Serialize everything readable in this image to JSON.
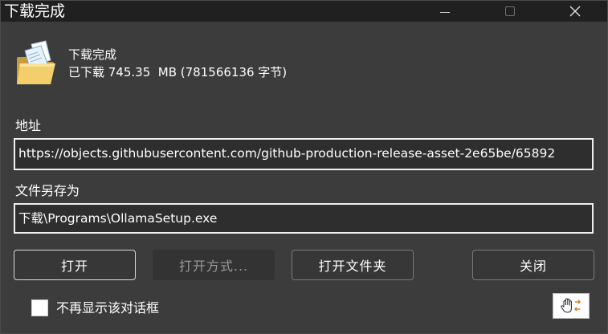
{
  "window": {
    "title": "下载完成",
    "close_glyph": "✕"
  },
  "header": {
    "icon": "folder-icon",
    "title": "下载完成",
    "size_text": "已下载 745.35  MB (781566136 字节)"
  },
  "url_section": {
    "label": "地址",
    "value": "https://objects.githubusercontent.com/github-production-release-asset-2e65be/65892"
  },
  "save_section": {
    "label": "文件另存为",
    "value": "下载\\Programs\\OllamaSetup.exe"
  },
  "buttons": {
    "open": "打开",
    "open_with": "打开方式...",
    "open_folder": "打开文件夹",
    "close": "关闭"
  },
  "footer": {
    "checkbox_label": "不再显示该对话框",
    "checkbox_checked": false,
    "tool_icon": "hand-drag-icon"
  },
  "colors": {
    "window_bg": "#3c3c3c",
    "titlebar_bg": "#202020",
    "disabled_text": "#9a9a9a"
  }
}
